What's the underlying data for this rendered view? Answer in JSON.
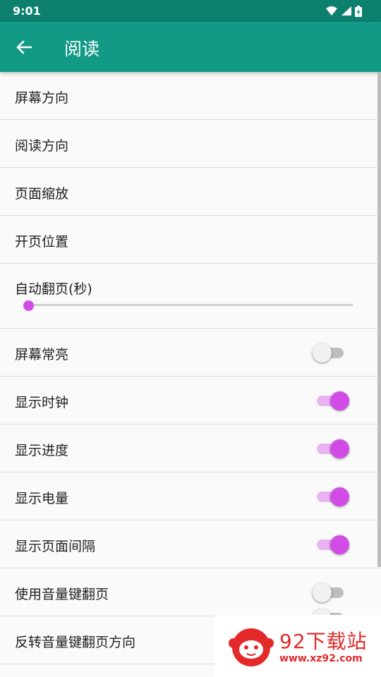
{
  "status_bar": {
    "time": "9:01"
  },
  "app_bar": {
    "title": "阅读"
  },
  "settings": [
    {
      "label": "屏幕方向"
    },
    {
      "label": "阅读方向"
    },
    {
      "label": "页面缩放"
    },
    {
      "label": "开页位置"
    },
    {
      "label": "自动翻页(秒)",
      "slider_value": 0
    },
    {
      "label": "屏幕常亮",
      "enabled": false
    },
    {
      "label": "显示时钟",
      "enabled": true
    },
    {
      "label": "显示进度",
      "enabled": true
    },
    {
      "label": "显示电量",
      "enabled": true
    },
    {
      "label": "显示页面间隔",
      "enabled": true
    },
    {
      "label": "使用音量键翻页",
      "enabled": false
    },
    {
      "label": "反转音量键翻页方向",
      "enabled": false
    }
  ],
  "watermark": {
    "brand": "92下载站",
    "url": "www.xz92.com"
  },
  "colors": {
    "status_bar": "#0d7f6d",
    "app_bar": "#139a87",
    "accent": "#d14be6",
    "watermark": "#e3292a"
  }
}
